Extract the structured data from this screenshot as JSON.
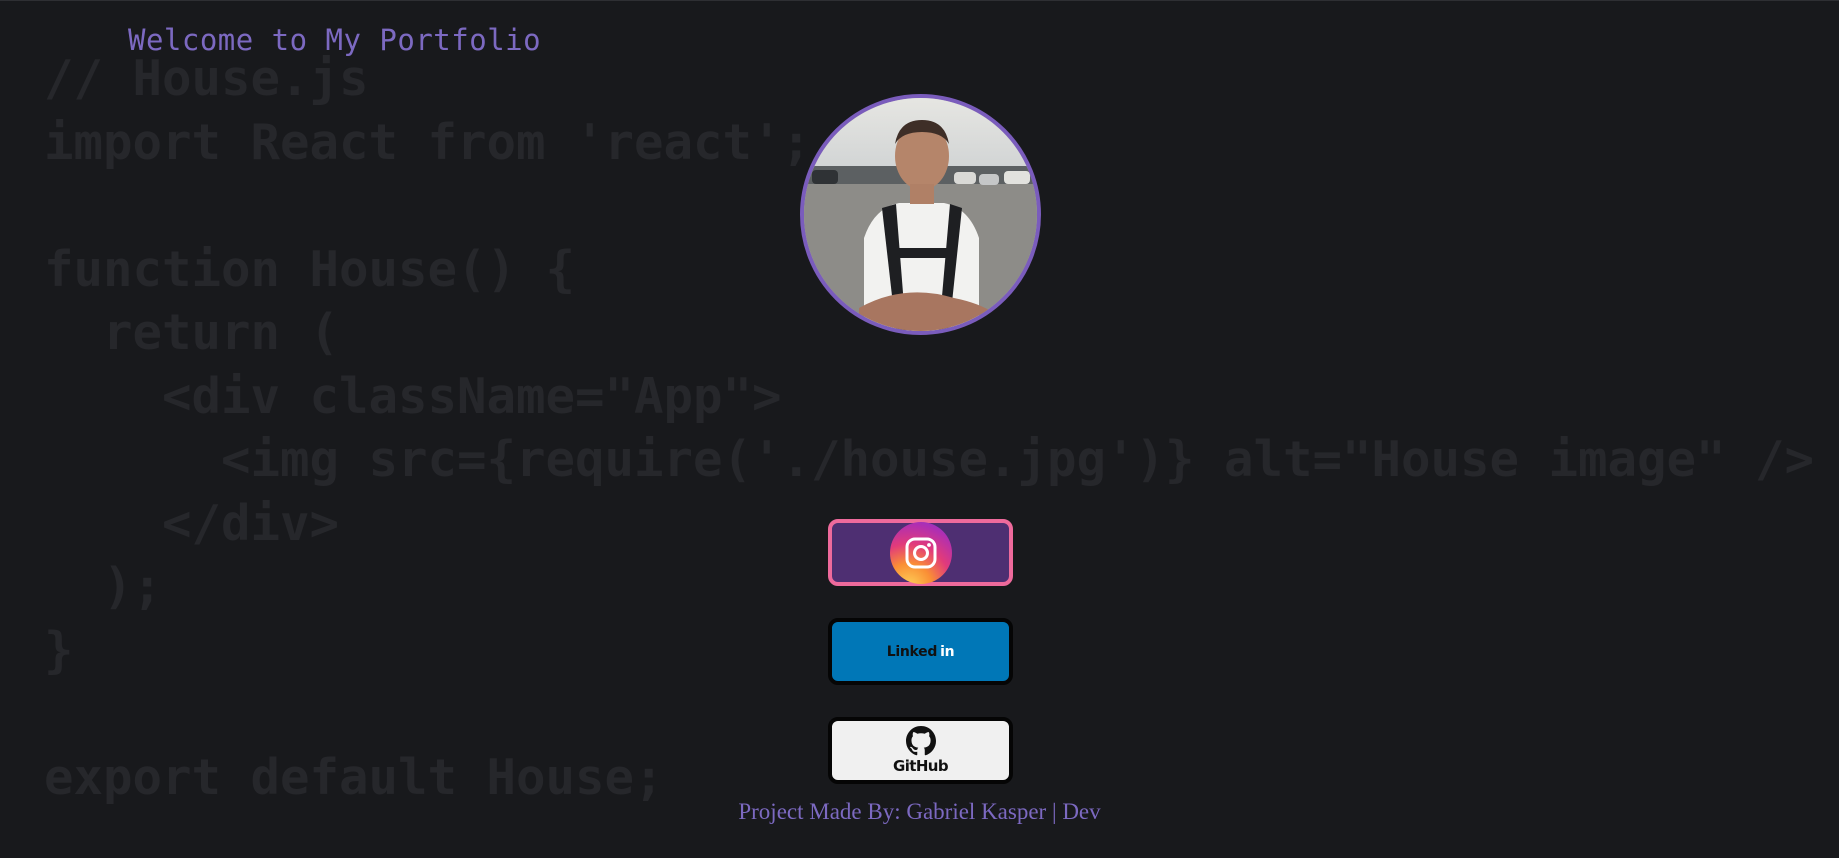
{
  "background": {
    "code_lines": [
      "// House.js",
      "import React from 'react';",
      "",
      "function House() {",
      "  return (",
      "    <div className=\"App\">",
      "      <img src={require('./house.jpg')} alt=\"House image\" />",
      "    </div>",
      "  );",
      "}",
      "",
      "export default House;"
    ]
  },
  "header": {
    "title": "Welcome to My Portfolio"
  },
  "profile": {
    "avatar_icon": "profile-photo"
  },
  "social": {
    "instagram": {
      "icon": "instagram-icon"
    },
    "linkedin": {
      "label_main": "Linked",
      "label_in": "in"
    },
    "github": {
      "label": "GitHub",
      "icon": "github-icon"
    }
  },
  "footer": {
    "text": "Project Made By: Gabriel Kasper | Dev"
  },
  "colors": {
    "background": "#18191c",
    "accent": "#7c69c1",
    "instagram_bg": "#4e2f72",
    "instagram_border": "#ee6a9c",
    "linkedin_bg": "#0077b7",
    "github_bg": "#f0f0f0"
  }
}
